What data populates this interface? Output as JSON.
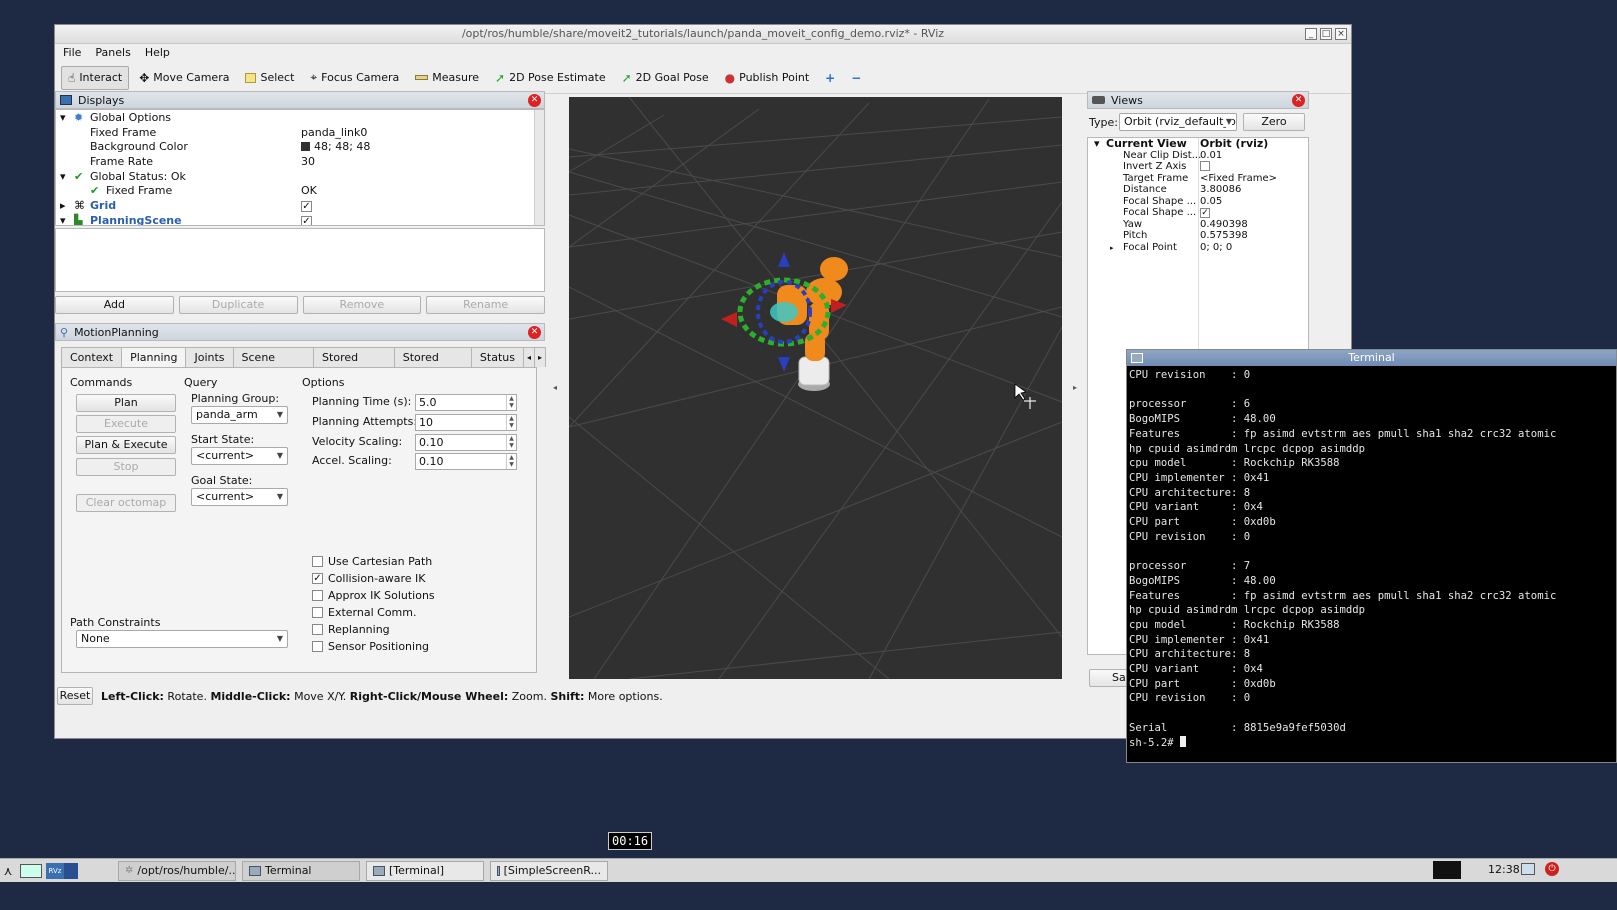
{
  "rviz": {
    "title": "/opt/ros/humble/share/moveit2_tutorials/launch/panda_moveit_config_demo.rviz* - RViz",
    "menu": [
      "File",
      "Panels",
      "Help"
    ],
    "tools": [
      "Interact",
      "Move Camera",
      "Select",
      "Focus Camera",
      "Measure",
      "2D Pose Estimate",
      "2D Goal Pose",
      "Publish Point"
    ]
  },
  "displays": {
    "title": "Displays",
    "rows": [
      {
        "key": "Global Options",
        "value": ""
      },
      {
        "key": "Fixed Frame",
        "value": "panda_link0"
      },
      {
        "key": "Background Color",
        "value": "48; 48; 48"
      },
      {
        "key": "Frame Rate",
        "value": "30"
      },
      {
        "key": "Global Status: Ok",
        "value": ""
      },
      {
        "key": "Fixed Frame",
        "value": "OK"
      },
      {
        "key": "Grid",
        "value": "✓"
      },
      {
        "key": "PlanningScene",
        "value": "✓"
      }
    ],
    "buttons": [
      "Add",
      "Duplicate",
      "Remove",
      "Rename"
    ]
  },
  "motion": {
    "title": "MotionPlanning",
    "tabs": [
      "Context",
      "Planning",
      "Joints",
      "Scene Objects",
      "Stored Scenes",
      "Stored States",
      "Status"
    ],
    "commands_label": "Commands",
    "query_label": "Query",
    "options_label": "Options",
    "plan": "Plan",
    "execute": "Execute",
    "plan_execute": "Plan & Execute",
    "stop": "Stop",
    "clear_octomap": "Clear octomap",
    "planning_group_label": "Planning Group:",
    "planning_group": "panda_arm",
    "start_state_label": "Start State:",
    "start_state": "<current>",
    "goal_state_label": "Goal State:",
    "goal_state": "<current>",
    "planning_time_label": "Planning Time (s):",
    "planning_time": "5.0",
    "planning_attempts_label": "Planning Attempts:",
    "planning_attempts": "10",
    "velocity_label": "Velocity Scaling:",
    "velocity": "0.10",
    "accel_label": "Accel. Scaling:",
    "accel": "0.10",
    "checks": [
      {
        "label": "Use Cartesian Path",
        "checked": false
      },
      {
        "label": "Collision-aware IK",
        "checked": true
      },
      {
        "label": "Approx IK Solutions",
        "checked": false
      },
      {
        "label": "External Comm.",
        "checked": false
      },
      {
        "label": "Replanning",
        "checked": false
      },
      {
        "label": "Sensor Positioning",
        "checked": false
      }
    ],
    "path_constraints_label": "Path Constraints",
    "path_constraints": "None"
  },
  "status": {
    "reset": "Reset",
    "help_bold1": "Left-Click:",
    "help1": " Rotate. ",
    "help_bold2": "Middle-Click:",
    "help2": " Move X/Y. ",
    "help_bold3": "Right-Click/Mouse Wheel:",
    "help3": " Zoom. ",
    "help_bold4": "Shift:",
    "help4": " More options."
  },
  "views": {
    "title": "Views",
    "type_label": "Type:",
    "type_value": "Orbit (rviz_default_plu",
    "zero": "Zero",
    "rows": [
      {
        "key": "Current View",
        "value": "Orbit (rviz)"
      },
      {
        "key": "Near Clip Dist...",
        "value": "0.01"
      },
      {
        "key": "Invert Z Axis",
        "value": ""
      },
      {
        "key": "Target Frame",
        "value": "<Fixed Frame>"
      },
      {
        "key": "Distance",
        "value": "3.80086"
      },
      {
        "key": "Focal Shape ...",
        "value": "0.05"
      },
      {
        "key": "Focal Shape ...",
        "value": "✓"
      },
      {
        "key": "Yaw",
        "value": "0.490398"
      },
      {
        "key": "Pitch",
        "value": "0.575398"
      },
      {
        "key": "Focal Point",
        "value": "0; 0; 0"
      }
    ],
    "save_partial": "Sa"
  },
  "terminal": {
    "title": "Terminal",
    "text": "CPU revision    : 0\n\nprocessor       : 6\nBogoMIPS        : 48.00\nFeatures        : fp asimd evtstrm aes pmull sha1 sha2 crc32 atomic\nhp cpuid asimdrdm lrcpc dcpop asimddp\ncpu model       : Rockchip RK3588\nCPU implementer : 0x41\nCPU architecture: 8\nCPU variant     : 0x4\nCPU part        : 0xd0b\nCPU revision    : 0\n\nprocessor       : 7\nBogoMIPS        : 48.00\nFeatures        : fp asimd evtstrm aes pmull sha1 sha2 crc32 atomic\nhp cpuid asimdrdm lrcpc dcpop asimddp\ncpu model       : Rockchip RK3588\nCPU implementer : 0x41\nCPU architecture: 8\nCPU variant     : 0x4\nCPU part        : 0xd0b\nCPU revision    : 0\n\nSerial          : 8815e9a9fef5030d",
    "prompt": "sh-5.2# "
  },
  "taskbar": {
    "tasks": [
      "/opt/ros/humble/...",
      "Terminal",
      "[Terminal]",
      "[SimpleScreenR..."
    ],
    "clock": "12:38",
    "rviz_badge": "RVz"
  },
  "timer": "00:16",
  "colors": {
    "background": "#1e2a44",
    "grid_bg": "#303030",
    "robot": "#f08a1c",
    "link_blue": "#2a5fb0"
  }
}
